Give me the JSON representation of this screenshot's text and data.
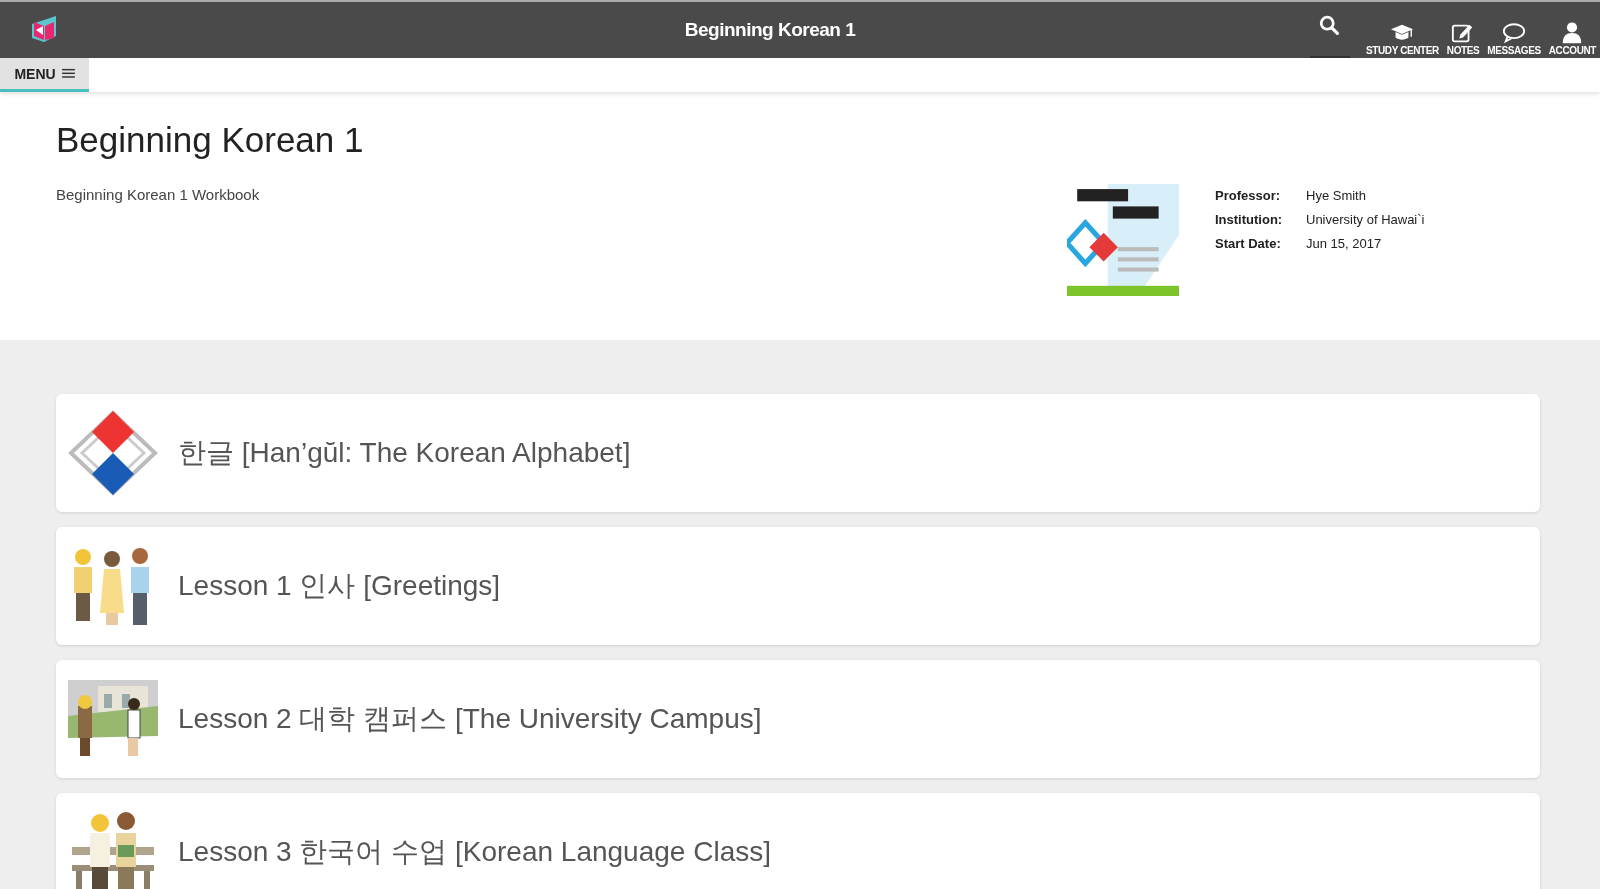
{
  "header": {
    "title": "Beginning Korean 1"
  },
  "nav": [
    {
      "kind": "search"
    },
    {
      "kind": "study",
      "label": "STUDY CENTER"
    },
    {
      "kind": "notes",
      "label": "NOTES"
    },
    {
      "kind": "messages",
      "label": "MESSAGES"
    },
    {
      "kind": "account",
      "label": "ACCOUNT"
    }
  ],
  "menu": {
    "label": "MENU",
    "selected": true
  },
  "course": {
    "title": "Beginning Korean 1",
    "subtitle": "Beginning Korean 1 Workbook",
    "details": [
      {
        "label": "Professor:",
        "value": "Hye Smith"
      },
      {
        "label": "Institution:",
        "value": "University of Hawai`i"
      },
      {
        "label": "Start Date:",
        "value": "Jun 15, 2017"
      }
    ]
  },
  "lessons": [
    {
      "kind": "diamond",
      "title": "한글 [Han’gŭl: The Korean Alphabet]"
    },
    {
      "kind": "people",
      "title": "Lesson 1 인사 [Greetings]"
    },
    {
      "kind": "campus",
      "title": "Lesson 2 대학 캠퍼스 [The University Campus]"
    },
    {
      "kind": "bench",
      "title": "Lesson 3 한국어 수업 [Korean Language Class]"
    }
  ]
}
